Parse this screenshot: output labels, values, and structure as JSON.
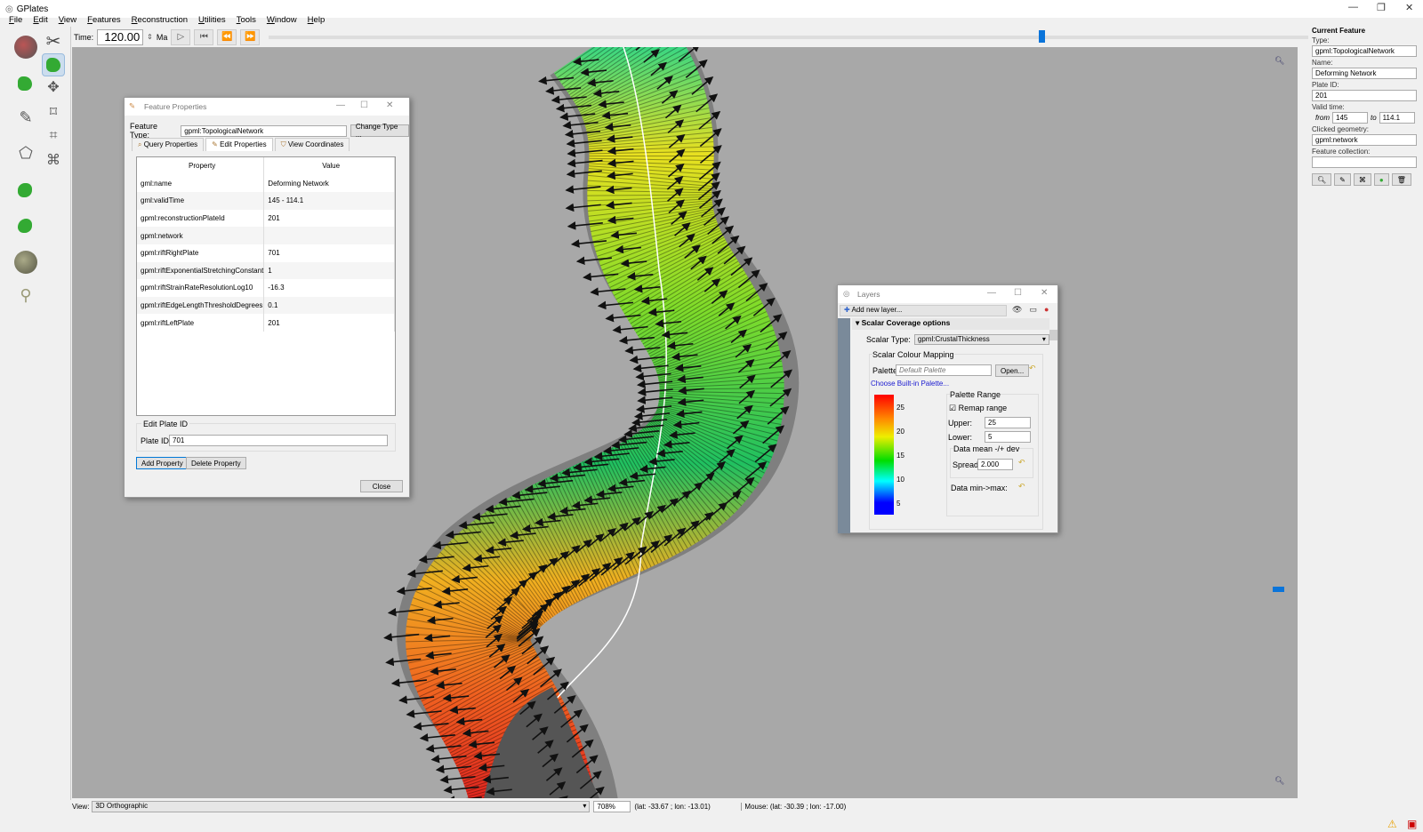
{
  "app": {
    "title": "GPlates"
  },
  "menu": [
    "File",
    "Edit",
    "View",
    "Features",
    "Reconstruction",
    "Utilities",
    "Tools",
    "Window",
    "Help"
  ],
  "timebar": {
    "label": "Time:",
    "value": "120.00",
    "unit": "Ma",
    "slider_fraction": 0.74
  },
  "feature_properties": {
    "title": "Feature Properties",
    "feature_type_label": "Feature Type:",
    "feature_type": "gpml:TopologicalNetwork",
    "change_type": "Change Type ...",
    "tabs": [
      "Query Properties",
      "Edit Properties",
      "View Coordinates"
    ],
    "active_tab": 1,
    "columns": [
      "Property",
      "Value"
    ],
    "rows": [
      [
        "gml:name",
        "Deforming Network"
      ],
      [
        "gml:validTime",
        "145 - 114.1"
      ],
      [
        "gpml:reconstructionPlateId",
        "201"
      ],
      [
        "gpml:network",
        ""
      ],
      [
        "gpml:riftRightPlate",
        "701"
      ],
      [
        "gpml:riftExponentialStretchingConstant",
        "1"
      ],
      [
        "gpml:riftStrainRateResolutionLog10",
        "-16.3"
      ],
      [
        "gpml:riftEdgeLengthThresholdDegrees",
        "0.1"
      ],
      [
        "gpml:riftLeftPlate",
        "201"
      ]
    ],
    "edit_plate_group": "Edit Plate ID",
    "plate_id_label": "Plate ID:",
    "plate_id": "701",
    "add_property": "Add Property",
    "delete_property": "Delete Property",
    "close": "Close"
  },
  "layers": {
    "title": "Layers",
    "add_layer": "Add new layer...",
    "section": "Scalar Coverage options",
    "scalar_type_label": "Scalar Type:",
    "scalar_type": "gpml:CrustalThickness",
    "mapping_group": "Scalar Colour  Mapping",
    "palette_label": "Palette:",
    "palette_placeholder": "Default Palette",
    "open": "Open...",
    "builtin_link": "Choose Built-in Palette...",
    "ticks": [
      "25",
      "20",
      "15",
      "10",
      "5"
    ],
    "range_group": "Palette Range",
    "remap": "Remap range",
    "remap_checked": true,
    "upper_label": "Upper:",
    "upper": "25",
    "lower_label": "Lower:",
    "lower": "5",
    "mean_group": "Data mean -/+ dev",
    "spread_label": "Spread:",
    "spread": "2.000",
    "minmax_label": "Data min->max:"
  },
  "current_feature": {
    "heading": "Current Feature",
    "type_label": "Type:",
    "type": "gpml:TopologicalNetwork",
    "name_label": "Name:",
    "name": "Deforming Network",
    "plate_label": "Plate ID:",
    "plate": "201",
    "valid_label": "Valid time:",
    "from_label": "from",
    "from": "145",
    "to_label": "to",
    "to": "114.1",
    "geom_label": "Clicked geometry:",
    "geom": "gpml:network",
    "coll_label": "Feature collection:",
    "coll": ""
  },
  "status": {
    "view_label": "View:",
    "view": "3D Orthographic",
    "zoom": "708%",
    "camera": "(lat: -33.67 ; lon: -13.01)",
    "mouse": "Mouse: (lat: -30.39 ; lon: -17.00)"
  }
}
